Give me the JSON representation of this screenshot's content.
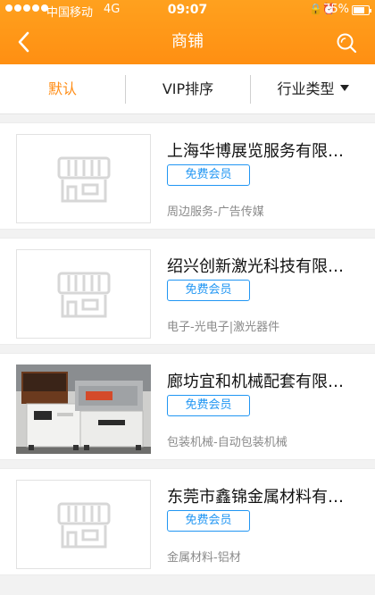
{
  "status_bar": {
    "carrier": "中国移动",
    "network": "4G",
    "time": "09:07",
    "battery": "75%",
    "battery_level": 0.75
  },
  "header": {
    "title": "商铺"
  },
  "tabs": [
    {
      "label": "默认",
      "active": true
    },
    {
      "label": "VIP排序",
      "active": false
    },
    {
      "label": "行业类型",
      "active": false
    }
  ],
  "shops": [
    {
      "name": "上海华博展览服务有限公司",
      "badge": "免费会员",
      "category": "周边服务-广告传媒",
      "image": "placeholder-shop-icon"
    },
    {
      "name": "绍兴创新激光科技有限公司",
      "badge": "免费会员",
      "category": "电子-光电子|激光器件",
      "image": "placeholder-shop-icon"
    },
    {
      "name": "廊坊宜和机械配套有限公司",
      "badge": "免费会员",
      "category": "包装机械-自动包装机械",
      "image": "shrink-wrap-machine-photo"
    },
    {
      "name": "东莞市鑫锦金属材料有限公司",
      "badge": "免费会员",
      "category": "金属材料-铝材",
      "image": "placeholder-shop-icon"
    }
  ],
  "colors": {
    "accent": "#ff8c14",
    "badge": "#2196f3"
  }
}
